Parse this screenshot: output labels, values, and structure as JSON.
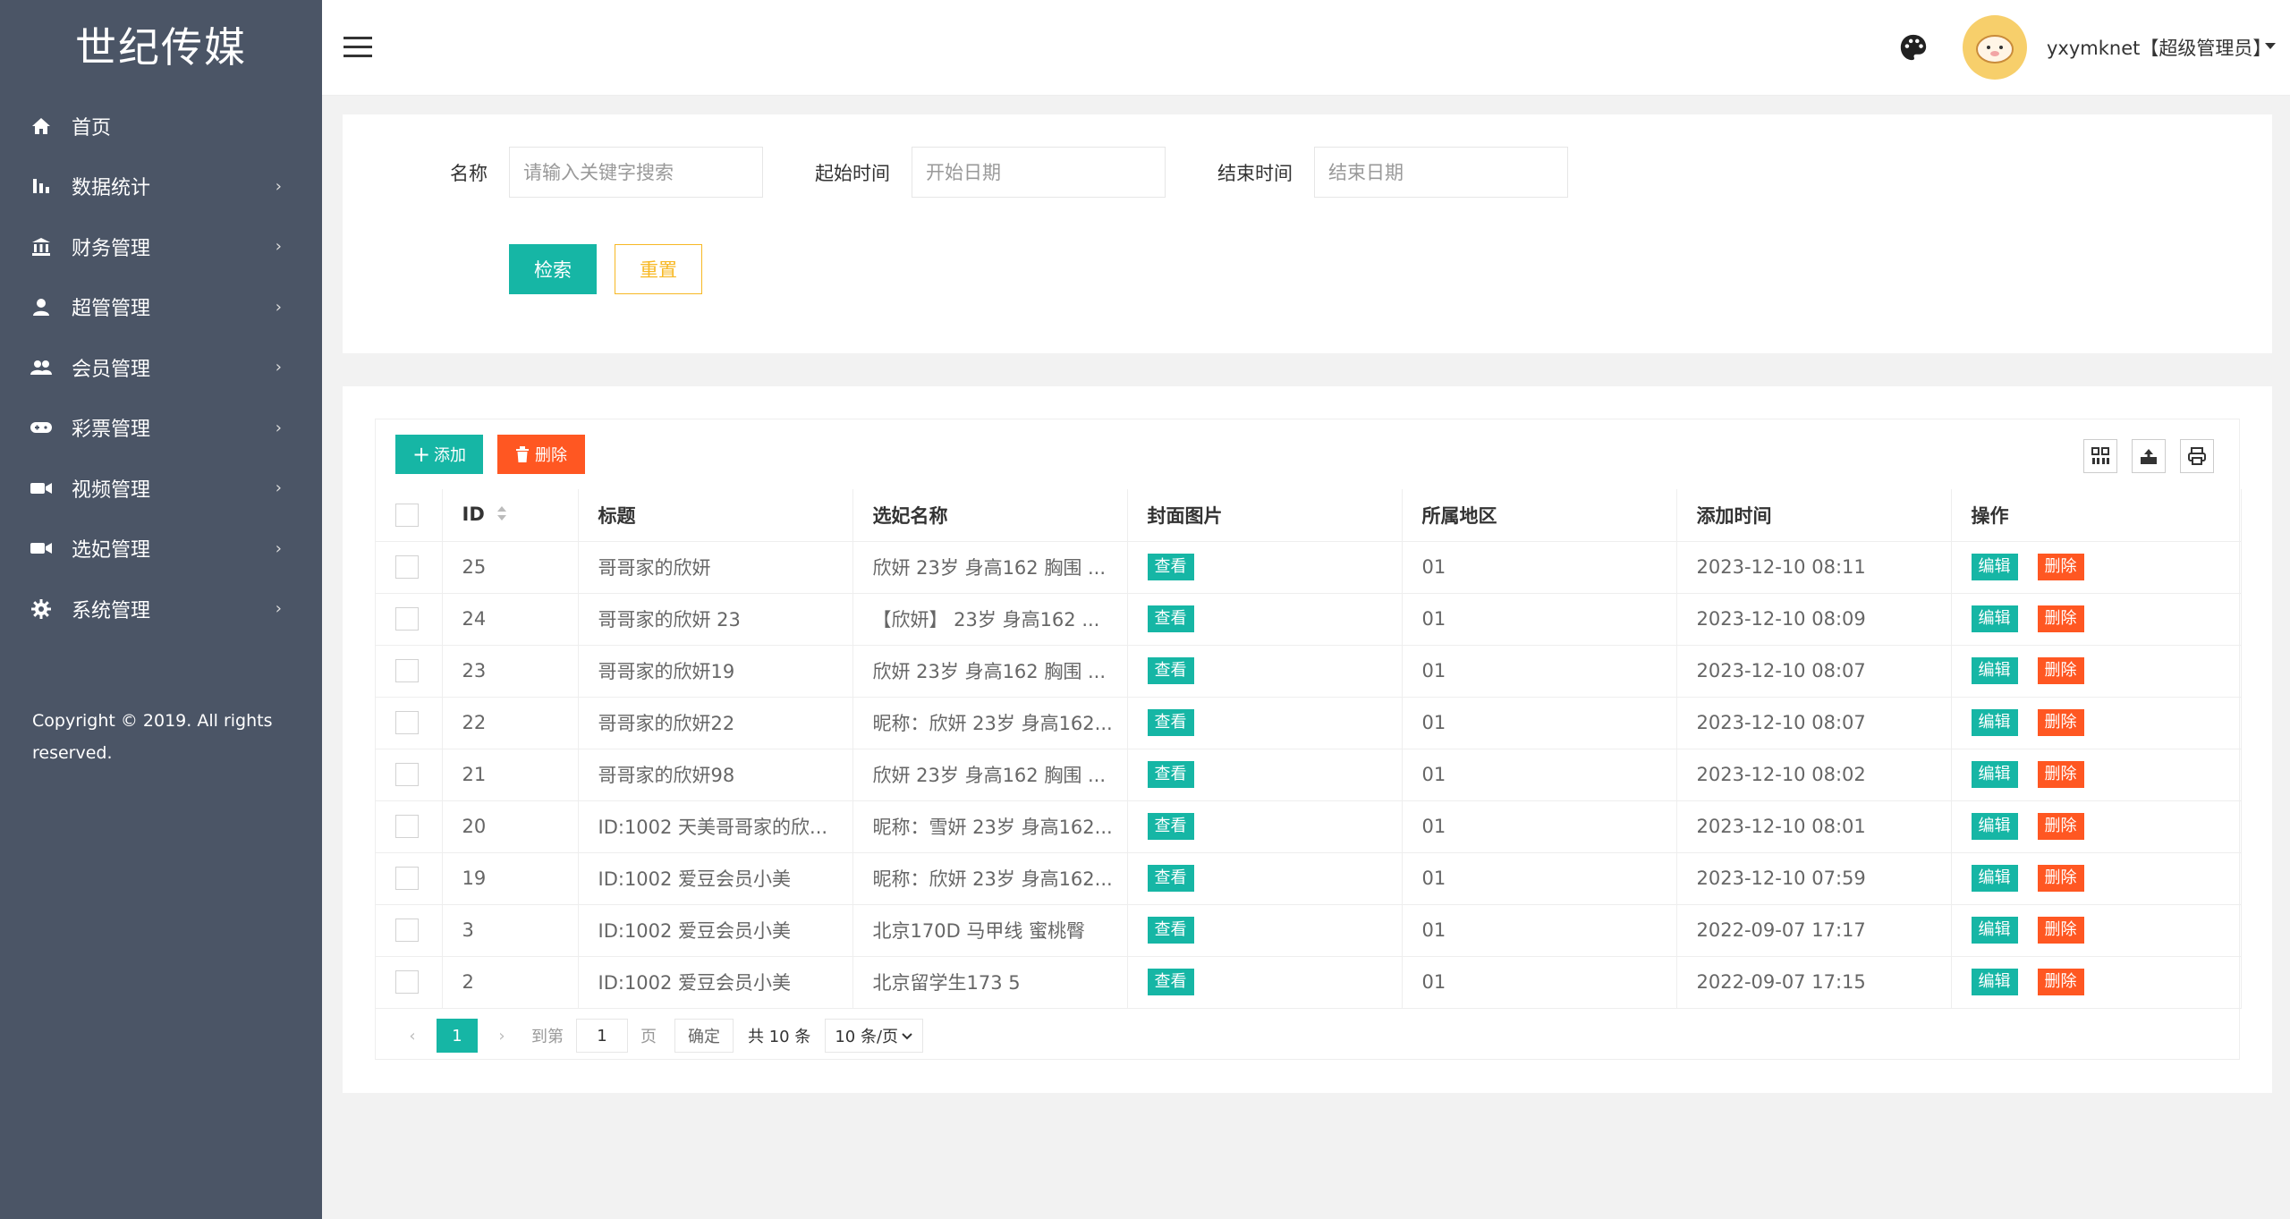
{
  "brand": "世纪传媒",
  "sidebar": {
    "items": [
      {
        "label": "首页",
        "icon": "home-icon",
        "arrow": ""
      },
      {
        "label": "数据统计",
        "icon": "bar-chart-icon",
        "arrow": "›"
      },
      {
        "label": "财务管理",
        "icon": "bank-icon",
        "arrow": "›"
      },
      {
        "label": "超管管理",
        "icon": "user-icon",
        "arrow": "›"
      },
      {
        "label": "会员管理",
        "icon": "users-icon",
        "arrow": "›"
      },
      {
        "label": "彩票管理",
        "icon": "gamepad-icon",
        "arrow": "›"
      },
      {
        "label": "视频管理",
        "icon": "video-camera-icon",
        "arrow": "›"
      },
      {
        "label": "选妃管理",
        "icon": "video-camera-icon",
        "arrow": "›"
      },
      {
        "label": "系统管理",
        "icon": "gear-icon",
        "arrow": "›"
      }
    ],
    "copyright": "Copyright © 2019. All rights reserved."
  },
  "header": {
    "username": "yxymknet【超级管理员】"
  },
  "search": {
    "name_label": "名称",
    "name_placeholder": "请输入关键字搜索",
    "start_label": "起始时间",
    "start_placeholder": "开始日期",
    "end_label": "结束时间",
    "end_placeholder": "结束日期",
    "search_btn": "检索",
    "reset_btn": "重置"
  },
  "toolbar": {
    "add_label": "添加",
    "delete_label": "删除"
  },
  "table": {
    "columns": [
      "ID",
      "标题",
      "选妃名称",
      "封面图片",
      "所属地区",
      "添加时间",
      "操作"
    ],
    "view_label": "查看",
    "edit_label": "编辑",
    "remove_label": "删除",
    "rows": [
      {
        "id": "25",
        "title": "哥哥家的欣妍",
        "name": "欣妍 23岁 身高162 胸围 ...",
        "region": "01",
        "time": "2023-12-10 08:11"
      },
      {
        "id": "24",
        "title": "哥哥家的欣妍 23",
        "name": "【欣妍】 23岁 身高162 ...",
        "region": "01",
        "time": "2023-12-10 08:09"
      },
      {
        "id": "23",
        "title": "哥哥家的欣妍19",
        "name": "欣妍 23岁 身高162 胸围 ...",
        "region": "01",
        "time": "2023-12-10 08:07"
      },
      {
        "id": "22",
        "title": "哥哥家的欣妍22",
        "name": "昵称：欣妍 23岁 身高162...",
        "region": "01",
        "time": "2023-12-10 08:07"
      },
      {
        "id": "21",
        "title": "哥哥家的欣妍98",
        "name": "欣妍 23岁 身高162 胸围 ...",
        "region": "01",
        "time": "2023-12-10 08:02"
      },
      {
        "id": "20",
        "title": "ID:1002 天美哥哥家的欣...",
        "name": "昵称：雪妍 23岁 身高162...",
        "region": "01",
        "time": "2023-12-10 08:01"
      },
      {
        "id": "19",
        "title": "ID:1002 爱豆会员小美",
        "name": "昵称：欣妍 23岁 身高162...",
        "region": "01",
        "time": "2023-12-10 07:59"
      },
      {
        "id": "3",
        "title": "ID:1002 爱豆会员小美",
        "name": "北京170D 马甲线 蜜桃臀",
        "region": "01",
        "time": "2022-09-07 17:17"
      },
      {
        "id": "2",
        "title": "ID:1002 爱豆会员小美",
        "name": "北京留学生173 5",
        "region": "01",
        "time": "2022-09-07 17:15"
      }
    ]
  },
  "pager": {
    "prev": "‹",
    "current": "1",
    "next": "›",
    "goto_label": "到第",
    "goto_value": "1",
    "page_label": "页",
    "confirm_label": "确定",
    "total_label": "共 10 条",
    "limit_label": "10 条/页"
  }
}
